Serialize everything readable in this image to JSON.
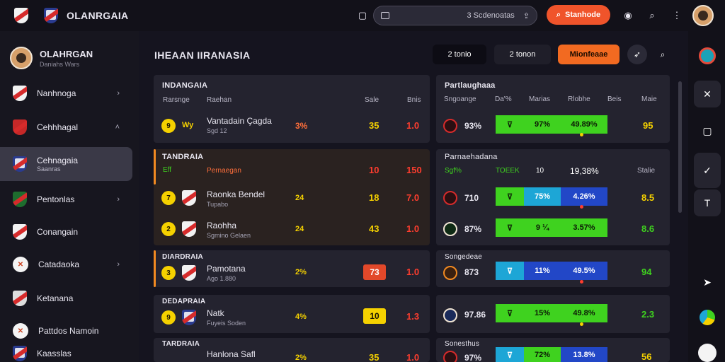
{
  "app": {
    "brand": "OLANRGAIA"
  },
  "search": {
    "placeholder": "3 Scdenoatas"
  },
  "header": {
    "cta_label": "Stanhode"
  },
  "sidebar": {
    "profile_name": "OLAHRGAN",
    "profile_sub": "Daniahs Wars",
    "items": [
      {
        "label": "Nanhnoga",
        "chevron": "›"
      },
      {
        "label": "Cehhhagal",
        "chevron": "˄"
      },
      {
        "label": "Cehnagaia",
        "sub": "Saanras"
      },
      {
        "label": "Pentonlas",
        "chevron": "›"
      },
      {
        "label": "Conangain",
        "chevron": ""
      },
      {
        "label": "Catadaoka",
        "chevron": "›"
      },
      {
        "label": "Ketanana",
        "chevron": ""
      },
      {
        "label": "Pattdos Namoin",
        "chevron": ""
      },
      {
        "label": "Kaasslas",
        "chevron": ""
      }
    ]
  },
  "main": {
    "title": "IHEAAN IIRANASIA",
    "pill_1": "2 tonio",
    "pill_2": "2 tonon",
    "pill_3": "Mionfeaae"
  },
  "left_table": {
    "title": "INDANGAIA",
    "headers": [
      "Rarsnge",
      "Raehan",
      "Sale",
      "Bnis"
    ],
    "rows": [
      {
        "num": "9",
        "tag": "Wy",
        "name": "Vantadain Çagda",
        "sub": "Sgd 12",
        "pct": "3%",
        "a": "35",
        "b": "1.0"
      },
      {
        "section": "TANDRAIA",
        "tag": "Eff",
        "name": "Pernaegan",
        "a": "10",
        "b": "150"
      },
      {
        "num": "7",
        "name": "Raonka Bendel",
        "sub": "Tupabo",
        "pct": "24",
        "a": "18",
        "b": "7.0"
      },
      {
        "num": "2",
        "name": "Raohha",
        "sub": "Sgmino Gelaen",
        "pct": "24",
        "a": "43",
        "b": "1.0"
      },
      {
        "section": "DIARDRAIA",
        "num": "3",
        "name": "Pamotana",
        "sub": "Ago 1.880",
        "pct": "2%",
        "a": "73",
        "b": "1.0"
      },
      {
        "section": "DEDAPRAIA",
        "num": "9",
        "name": "Natk",
        "sub": "Fuyeis Soden",
        "pct": "4%",
        "a": "10",
        "b": "1.3"
      },
      {
        "section": "TARDRAIA",
        "name": "Hanlona Safl",
        "pct": "2%",
        "a": "35",
        "b": "1.0"
      }
    ]
  },
  "right_table": {
    "title": "Partlaughaaa",
    "headers": [
      "Sngoange",
      "Da'%",
      "Marias",
      "Rlobhe",
      "Beis",
      "Maie"
    ],
    "section_2_title": "Parnaehadana",
    "section_2_head": [
      "Sgf%",
      "TOEEK",
      "10",
      "19,38%",
      "Stalie"
    ],
    "section_5_title": "Songedeae",
    "section_6_title": "Sonesthus",
    "rows": [
      {
        "pct": "93%",
        "tri": "⊽",
        "seg1": "97%",
        "seg2": "49.89%",
        "val": "95"
      },
      {
        "pct": "710",
        "tri": "⊽",
        "seg1": "75%",
        "seg2": "4.26%",
        "val": "8.5"
      },
      {
        "pct": "87%",
        "tri": "⊽",
        "seg1": "9 ¼",
        "seg2": "3.57%",
        "val": "8.6"
      },
      {
        "pct": "873",
        "tri": "⊽",
        "seg1": "11%",
        "seg2": "49.5%",
        "val": "94"
      },
      {
        "pct": "97.86",
        "tri": "⊽",
        "seg1": "15%",
        "seg2": "49.8%",
        "val": "2.3"
      },
      {
        "pct": "97%",
        "tri": "⊽",
        "seg1": "72%",
        "seg2": "13.8%",
        "val": "56"
      }
    ]
  },
  "colors": {
    "accent": "#f0542b",
    "orange": "#f26a21",
    "yellow": "#f5d100",
    "green": "#3fd21f",
    "blue": "#2247c7",
    "red": "#ff3d2e"
  }
}
